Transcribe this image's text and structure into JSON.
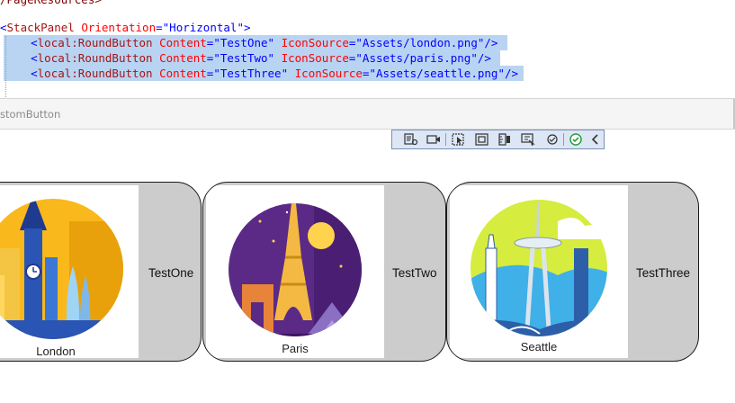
{
  "editor": {
    "line0": "/PageResources>",
    "line1": {
      "open": "<",
      "tag": "StackPanel",
      "attr": "Orientation",
      "eq": "=",
      "val": "\"Horizontal\"",
      "close": ">"
    },
    "buttons": [
      {
        "tag": "local:RoundButton",
        "content_attr": "Content",
        "content_val": "\"TestOne\"",
        "icon_attr": "IconSource",
        "icon_val": "\"Assets/london.png\""
      },
      {
        "tag": "local:RoundButton",
        "content_attr": "Content",
        "content_val": "\"TestTwo\"",
        "icon_attr": "IconSource",
        "icon_val": "\"Assets/paris.png\""
      },
      {
        "tag": "local:RoundButton",
        "content_attr": "Content",
        "content_val": "\"TestThree\"",
        "icon_attr": "IconSource",
        "icon_val": "\"Assets/seattle.png\""
      }
    ]
  },
  "tab": {
    "label": "stomButton"
  },
  "toolbar": {
    "icons": [
      "select-element-icon",
      "device-preview-icon",
      "pointer-icon",
      "frame-icon",
      "ruler-icon",
      "snap-icon",
      "view-icon",
      "check-icon",
      "collapse-chevron-icon"
    ],
    "accent": "#2e9e3e"
  },
  "preview": {
    "buttons": [
      {
        "caption": "London",
        "content": "TestOne"
      },
      {
        "caption": "Paris",
        "content": "TestTwo"
      },
      {
        "caption": "Seattle",
        "content": "TestThree"
      }
    ]
  }
}
